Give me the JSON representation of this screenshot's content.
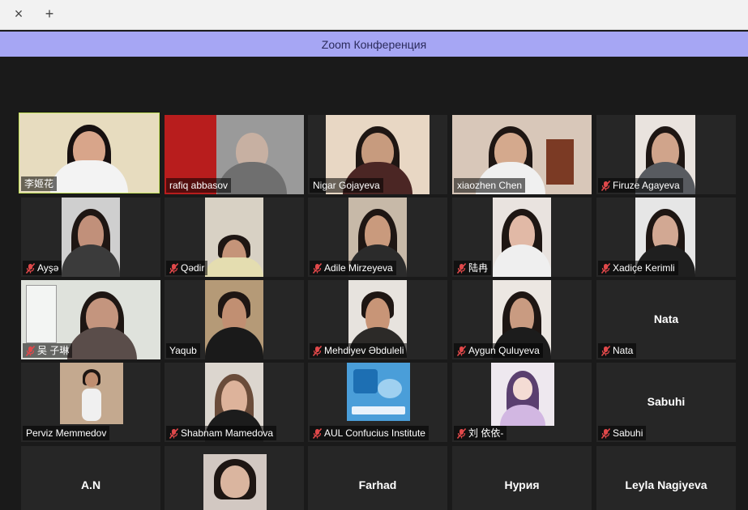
{
  "browser": {
    "close_glyph": "×",
    "new_tab_glyph": "+"
  },
  "window": {
    "title": "Zoom Конференция"
  },
  "participants": [
    {
      "name": "李姬花",
      "muted": false,
      "video": true,
      "active_speaker": true
    },
    {
      "name": "rafiq abbasov",
      "muted": false,
      "video": true
    },
    {
      "name": "Nigar Gojayeva",
      "muted": false,
      "video": true
    },
    {
      "name": "xiaozhen Chen",
      "muted": false,
      "video": true
    },
    {
      "name": "Firuze Agayeva",
      "muted": true,
      "video": true
    },
    {
      "name": "Ayşə",
      "muted": true,
      "video": true
    },
    {
      "name": "Qədir",
      "muted": true,
      "video": true
    },
    {
      "name": "Adile Mirzeyeva",
      "muted": true,
      "video": true
    },
    {
      "name": "陆冉",
      "muted": true,
      "video": true
    },
    {
      "name": "Xadiçe Kerimli",
      "muted": true,
      "video": true
    },
    {
      "name": "吴 子琳",
      "muted": true,
      "video": true
    },
    {
      "name": "Yaqub",
      "muted": false,
      "video": true
    },
    {
      "name": "Mehdiyev Əbduleli",
      "muted": true,
      "video": true
    },
    {
      "name": "Aygun Quluyeva",
      "muted": true,
      "video": true
    },
    {
      "name": "Nata",
      "muted": true,
      "video": false
    },
    {
      "name": "Perviz Memmedov",
      "muted": false,
      "video": true
    },
    {
      "name": "Shabnam Mamedova",
      "muted": true,
      "video": true
    },
    {
      "name": "AUL Confucius Institute",
      "muted": true,
      "video": true
    },
    {
      "name": "刘 依依-",
      "muted": true,
      "video": true
    },
    {
      "name": "Sabuhi",
      "muted": true,
      "video": false
    },
    {
      "name": "A.N",
      "muted": false,
      "video": false
    },
    {
      "name": "",
      "muted": false,
      "video": true
    },
    {
      "name": "Farhad",
      "muted": false,
      "video": false
    },
    {
      "name": "Нурия",
      "muted": false,
      "video": false
    },
    {
      "name": "Leyla Nagiyeva",
      "muted": false,
      "video": false
    }
  ],
  "colors": {
    "active_speaker_border": "#c5e35a",
    "title_bar": "#a6a6f4",
    "muted_icon": "#e0484a"
  }
}
